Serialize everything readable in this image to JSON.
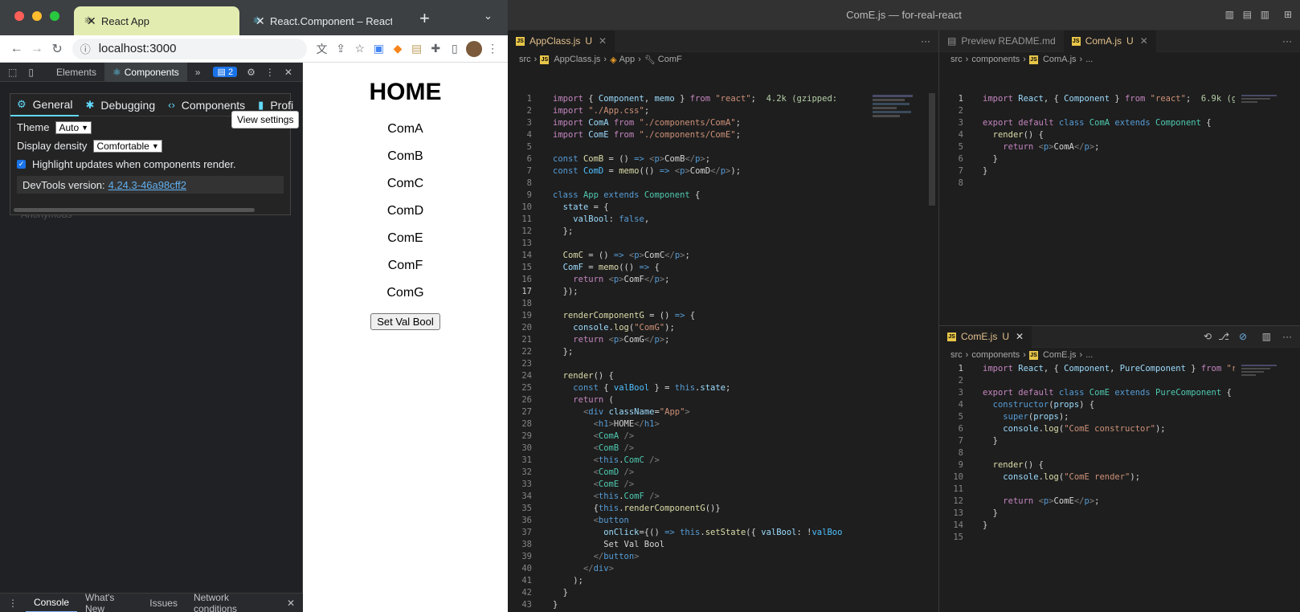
{
  "chrome": {
    "tabs": [
      {
        "title": "React App",
        "active": true
      },
      {
        "title": "React.Component – React",
        "active": false
      }
    ],
    "new_tab": "+",
    "url": "localhost:3000"
  },
  "devtools": {
    "tabs": [
      "Elements",
      "Components"
    ],
    "more": "»",
    "issues_count": "2",
    "settings": {
      "tabs": [
        "General",
        "Debugging",
        "Components",
        "Profi"
      ],
      "theme_label": "Theme",
      "theme_value": "Auto",
      "density_label": "Display density",
      "density_value": "Comfortable",
      "highlight_label": "Highlight updates when components render.",
      "version_label": "DevTools version:",
      "version_value": "4.24.3-46a98cff2"
    },
    "tooltip": "View settings",
    "hidden_text": "Anonymous",
    "drawer_tabs": [
      "Console",
      "What's New",
      "Issues",
      "Network conditions"
    ]
  },
  "page": {
    "heading": "HOME",
    "components": [
      "ComA",
      "ComB",
      "ComC",
      "ComD",
      "ComE",
      "ComF",
      "ComG"
    ],
    "button": "Set Val Bool"
  },
  "vscode": {
    "title": "ComE.js — for-real-react",
    "left_editor": {
      "tab": "AppClass.js",
      "tab_status": "U",
      "breadcrumb": [
        "src",
        "AppClass.js",
        "App",
        "ComF"
      ]
    },
    "right_top_editor": {
      "tabs": [
        "Preview README.md",
        "ComA.js"
      ],
      "tab_status": "U",
      "breadcrumb": [
        "src",
        "components",
        "ComA.js",
        "..."
      ]
    },
    "right_bottom_editor": {
      "tab": "ComE.js",
      "tab_status": "U",
      "breadcrumb": [
        "src",
        "components",
        "ComE.js",
        "..."
      ]
    }
  },
  "colors": {
    "react_accent": "#61dafb",
    "chrome_active_tab": "#e8f0a0",
    "chrome_tabstrip": "#3c4043",
    "vscode_bg": "#1e1e1e"
  }
}
